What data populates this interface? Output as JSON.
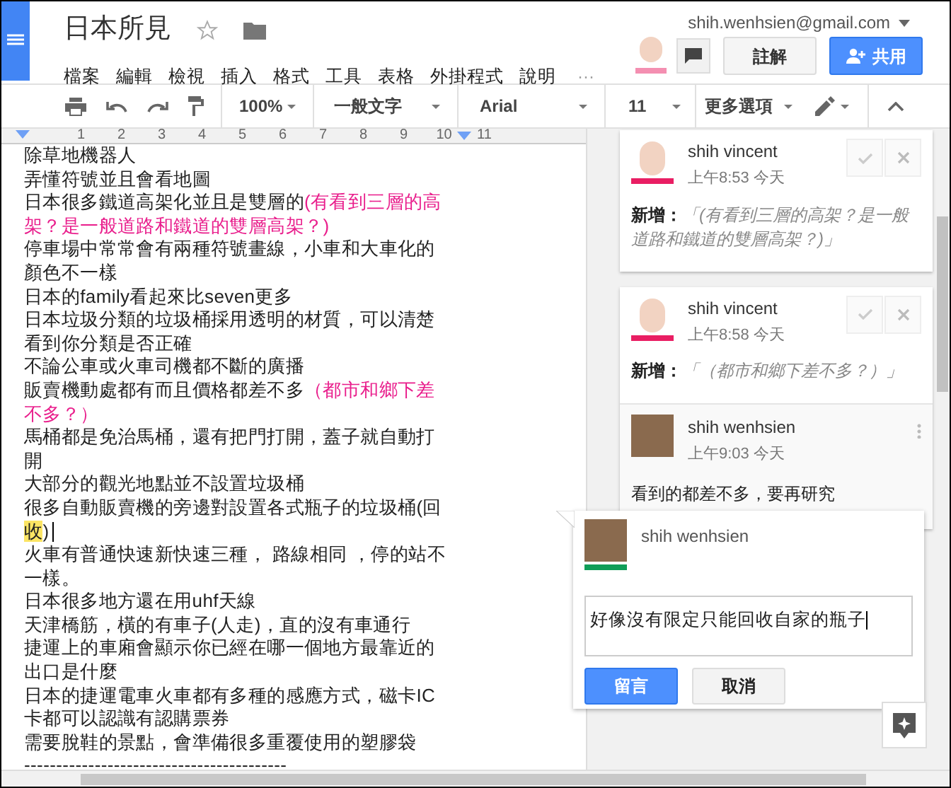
{
  "header": {
    "title": "日本所見",
    "account": "shih.wenhsien@gmail.com",
    "menu": [
      "檔案",
      "編輯",
      "檢視",
      "插入",
      "格式",
      "工具",
      "表格",
      "外掛程式",
      "說明"
    ],
    "menu_more": "···",
    "comments_button": "註解",
    "share_button": "共用"
  },
  "toolbar": {
    "zoom": "100%",
    "style": "一般文字",
    "font": "Arial",
    "size": "11",
    "more": "更多選項"
  },
  "ruler": [
    "1",
    "2",
    "3",
    "4",
    "5",
    "6",
    "7",
    "8",
    "9",
    "10",
    "11"
  ],
  "document": {
    "paragraphs": [
      [
        {
          "text": "除草地機器人",
          "kind": "normal"
        }
      ],
      [
        {
          "text": "弄懂符號並且會看地圖",
          "kind": "normal"
        }
      ],
      [
        {
          "text": "日本很多鐵道高架化並且是雙層的",
          "kind": "normal"
        },
        {
          "text": "(有看到三層的高架？是一般道路和鐵道的雙層高架？)",
          "kind": "suggestion"
        }
      ],
      [
        {
          "text": "停車場中常常會有兩種符號畫線，小車和大車化的顏色不一樣",
          "kind": "normal"
        }
      ],
      [
        {
          "text": "日本的family看起來比seven更多",
          "kind": "normal"
        }
      ],
      [
        {
          "text": "日本垃圾分類的垃圾桶採用透明的材質，可以清楚看到你分類是否正確",
          "kind": "normal"
        }
      ],
      [
        {
          "text": "不論公車或火車司機都不斷的廣播",
          "kind": "normal"
        }
      ],
      [
        {
          "text": "販賣機動處都有而且價格都差不多",
          "kind": "normal"
        },
        {
          "text": "（都市和鄉下差不多？）",
          "kind": "suggestion"
        }
      ],
      [
        {
          "text": "馬桶都是免治馬桶，還有把門打開，蓋子就自動打開",
          "kind": "normal"
        }
      ],
      [
        {
          "text": "大部分的觀光地點並不設置垃圾桶",
          "kind": "normal"
        }
      ],
      [
        {
          "text": "很多自動販賣機的旁邊對設置各式瓶子的垃圾桶(回",
          "kind": "normal"
        },
        {
          "text": "收",
          "kind": "highlight"
        },
        {
          "text": ")",
          "kind": "normal",
          "cursor": true
        }
      ],
      [
        {
          "text": "火車有普通快速新快速三種， 路線相同 ，停的站不一樣。",
          "kind": "normal"
        }
      ],
      [
        {
          "text": "日本很多地方還在用uhf天線",
          "kind": "normal"
        }
      ],
      [
        {
          "text": "天津橋筋，橫的有車子(人走)，直的沒有車通行",
          "kind": "normal"
        }
      ],
      [
        {
          "text": "捷運上的車廂會顯示你已經在哪一個地方最靠近的出口是什麼",
          "kind": "normal"
        }
      ],
      [
        {
          "text": "日本的捷運電車火車都有多種的感應方式，磁卡IC卡都可以認識有認購票券",
          "kind": "normal"
        }
      ],
      [
        {
          "text": "需要脫鞋的景點，會準備很多重覆使用的塑膠袋",
          "kind": "normal"
        }
      ],
      [
        {
          "text": "-----------------------------------------",
          "kind": "normal"
        }
      ]
    ]
  },
  "comments": [
    {
      "author": "shih vincent",
      "time": "上午8:53 今天",
      "label": "新增：",
      "quote": "「(有看到三層的高架？是一般道路和鐵道的雙層高架？)」",
      "color": "#e91e63"
    },
    {
      "author": "shih vincent",
      "time": "上午8:58 今天",
      "label": "新增：",
      "quote": "「（都市和鄉下差不多？）」",
      "color": "#e91e63",
      "replies": [
        {
          "author": "shih wenhsien",
          "time": "上午9:03 今天",
          "body": "看到的都差不多，要再研究"
        }
      ]
    }
  ],
  "composer": {
    "author": "shih wenhsien",
    "color": "#0f9d58",
    "value": "好像沒有限定只能回收自家的瓶子",
    "submit": "留言",
    "cancel": "取消"
  }
}
